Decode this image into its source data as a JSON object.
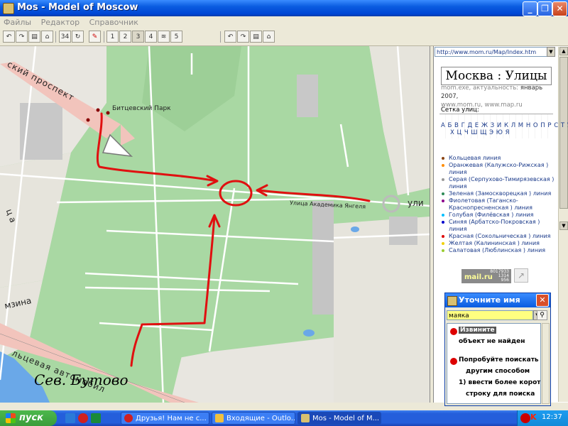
{
  "window": {
    "title": "Mos - Model of Moscow"
  },
  "menu": [
    "Файлы",
    "Редактор",
    "Справочник"
  ],
  "toolbar": {
    "scale": "34",
    "levels": [
      "1",
      "2",
      "3",
      "4",
      "5"
    ]
  },
  "map": {
    "labels": {
      "prospect": "ский  проспект",
      "park": "Битцевский Парк",
      "street": "Улица Академика Янгеля",
      "street_cut": "ули",
      "fragment1": "ц а",
      "fragment2": "мзина",
      "highway": "льцевая   автомобил",
      "handwriting": "Сев. Бутово"
    }
  },
  "panel": {
    "address": "http://www.mom.ru/Map/Index.htm",
    "title": "Москва : Улицы",
    "meta_prefix": "mom.exe, актуальность: ",
    "meta_date": "январь 2007,",
    "meta_sites": "www.mom.ru, www.map.ru",
    "grid_label": "Сетка улиц:",
    "alphabet_row1": "А Б В Г Д Е Ж З И К Л М Н О П Р С Т У Ф",
    "alphabet_row2": "Х Ц Ч Ш Щ Э Ю Я",
    "metro_lines": [
      {
        "label": "Кольцевая линия",
        "color": "#8b4513"
      },
      {
        "label": "Оранжевая (Калужско-Рижская ) линия",
        "color": "#ff8c00"
      },
      {
        "label": "Серая (Серпухово-Тимирязевская ) линия",
        "color": "#999999"
      },
      {
        "label": "Зеленая (Замоскворецкая ) линия",
        "color": "#2e8b57"
      },
      {
        "label": "Фиолетовая (Таганско-Краснопресненская ) линия",
        "color": "#8b008b"
      },
      {
        "label": "Голубая (Филёвская ) линия",
        "color": "#00bfff"
      },
      {
        "label": "Синяя (Арбатско-Покровская ) линия",
        "color": "#0000cd"
      },
      {
        "label": "Красная (Сокольническая ) линия",
        "color": "#dd0000"
      },
      {
        "label": "Желтая (Калининская ) линия",
        "color": "#f0d000"
      },
      {
        "label": "Салатовая (Люблинская ) линия",
        "color": "#9acd32"
      }
    ],
    "counter": {
      "brand": "mail.ru",
      "n1": "8017933",
      "n2": "1314",
      "n3": "956"
    }
  },
  "dialog": {
    "title": "Уточните имя",
    "input_value": "маяка",
    "sorry": "Извините",
    "not_found": "объект не найден",
    "try1": "Попробуйте поискать",
    "try2": "другим способом",
    "try3": "1) ввести более корот",
    "try4": "строку для поиска"
  },
  "taskbar": {
    "start": "пуск",
    "tasks": [
      "Друзья! Нам не с...",
      "Входящие - Outlo...",
      "Mos - Model of M..."
    ],
    "time": "12:37"
  }
}
